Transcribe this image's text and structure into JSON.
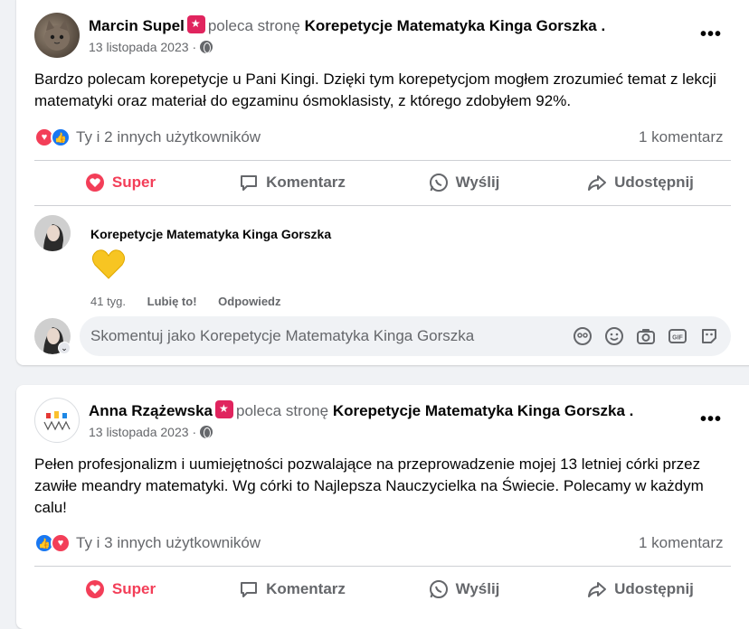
{
  "posts": [
    {
      "author": "Marcin Supel",
      "recommends_text": "poleca stronę",
      "page": "Korepetycje Matematyka Kinga Gorszka",
      "dot": ".",
      "date": "13 listopada 2023",
      "date_sep": "·",
      "more": "•••",
      "text": "Bardzo polecam korepetycje u Pani Kingi. Dzięki tym korepetycjom mogłem zrozumieć temat z lekcji matematyki oraz materiał do egzaminu ósmoklasisty, z którego zdobyłem 92%.",
      "reactions_text": "Ty i 2 innych użytkowników",
      "comments_count": "1 komentarz",
      "actions": {
        "react": "Super",
        "comment": "Komentarz",
        "send": "Wyślij",
        "share": "Udostępnij"
      },
      "comment": {
        "author": "Korepetycje Matematyka Kinga Gorszka",
        "time": "41 tyg.",
        "like": "Lubię to!",
        "reply": "Odpowiedz"
      },
      "composer_placeholder": "Skomentuj jako Korepetycje Matematyka Kinga Gorszka"
    },
    {
      "author": "Anna Rzążewska",
      "recommends_text": "poleca stronę",
      "page": "Korepetycje Matematyka Kinga Gorszka",
      "dot": ".",
      "date": "13 listopada 2023",
      "date_sep": "·",
      "more": "•••",
      "text": "Pełen profesjonalizm i uumiejętności pozwalające na przeprowadzenie mojej 13 letniej córki przez zawiłe meandry matematyki. Wg córki to Najlepsza Nauczycielka na Świecie. Polecamy w każdym calu!",
      "reactions_text": "Ty i 3 innych użytkowników",
      "comments_count": "1 komentarz",
      "actions": {
        "react": "Super",
        "comment": "Komentarz",
        "send": "Wyślij",
        "share": "Udostępnij"
      }
    }
  ],
  "colors": {
    "love": "#f33e58",
    "like": "#1877f2",
    "text_secondary": "#65676b"
  }
}
